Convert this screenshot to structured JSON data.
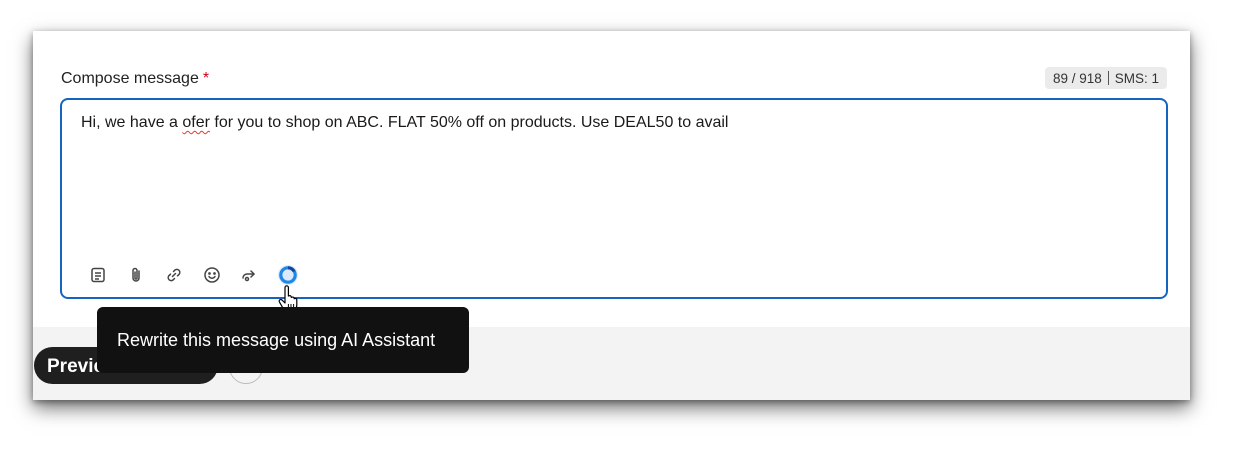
{
  "compose": {
    "label": "Compose message",
    "required_mark": "*",
    "counter": {
      "characters": "89 / 918",
      "sms": "SMS: 1"
    },
    "message": {
      "before": "Hi, we have a ",
      "misspelled": "ofer",
      "after": " for you to shop on ABC. FLAT 50% off on products. Use DEAL50 to avail"
    }
  },
  "toolbar": {
    "tools": [
      "template-icon",
      "attachment-icon",
      "link-icon",
      "emoji-icon",
      "personalize-icon",
      "ai-assistant-icon"
    ]
  },
  "tooltip": {
    "text": "Rewrite this message using AI Assistant"
  },
  "footer": {
    "preview_label": "Preview"
  },
  "colors": {
    "accent": "#1565c0",
    "required": "#d0021b",
    "tooltip_bg": "#111111",
    "ai_icon": "#1e88e5"
  }
}
